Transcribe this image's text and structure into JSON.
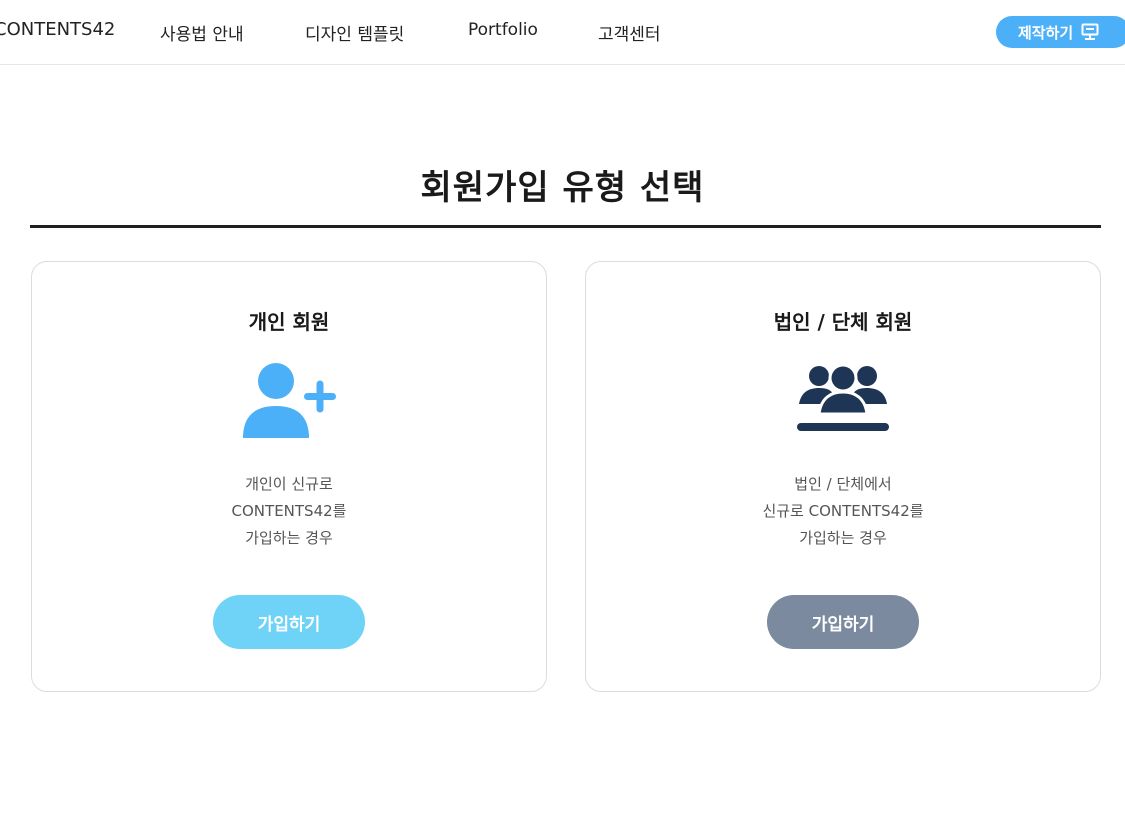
{
  "header": {
    "logo": "CONTENTS42",
    "nav": [
      {
        "label": "사용법 안내"
      },
      {
        "label": "디자인 템플릿"
      },
      {
        "label": "Portfolio"
      },
      {
        "label": "고객센터"
      }
    ],
    "cta_label": "제작하기",
    "cta_icon": "presentation-icon"
  },
  "page": {
    "title": "회원가입 유형 선택"
  },
  "cards": [
    {
      "title": "개인 회원",
      "icon": "user-plus-icon",
      "desc": [
        "개인이 신규로",
        "CONTENTS42를",
        "가입하는 경우"
      ],
      "button_label": "가입하기"
    },
    {
      "title": "법인 / 단체 회원",
      "icon": "group-users-icon",
      "desc": [
        "법인 / 단체에서",
        "신규로 CONTENTS42를",
        "가입하는 경우"
      ],
      "button_label": "가입하기"
    }
  ],
  "colors": {
    "cta": "#4bb0f7",
    "personal_icon": "#4bb0f7",
    "personal_button": "#6fd3f7",
    "corporate_icon": "#1f3556",
    "corporate_button": "#7b8a9e"
  }
}
